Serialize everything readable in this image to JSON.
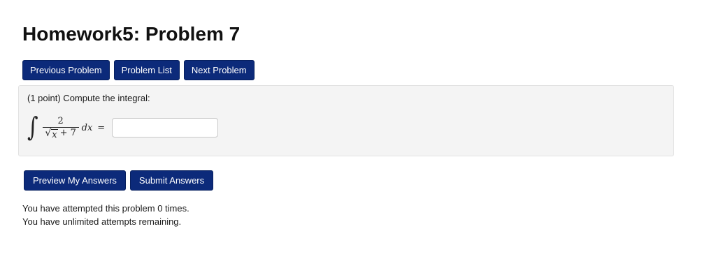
{
  "page": {
    "title": "Homework5: Problem 7"
  },
  "nav": {
    "previous_label": "Previous Problem",
    "list_label": "Problem List",
    "next_label": "Next Problem"
  },
  "problem": {
    "prompt": "(1 point) Compute the integral:",
    "integral": {
      "sign": "∫",
      "numerator": "2",
      "sqrt_symbol": "√",
      "radicand": "x",
      "denominator_rest": "+ 7",
      "differential": "dx",
      "equals": "="
    },
    "answer": {
      "value": "",
      "placeholder": ""
    }
  },
  "actions": {
    "preview_label": "Preview My Answers",
    "submit_label": "Submit Answers"
  },
  "attempts": {
    "line1": "You have attempted this problem 0 times.",
    "line2": "You have unlimited attempts remaining."
  },
  "colors": {
    "button_bg": "#0c2a7a",
    "button_text": "#ffffff",
    "problem_bg": "#f4f4f4"
  }
}
